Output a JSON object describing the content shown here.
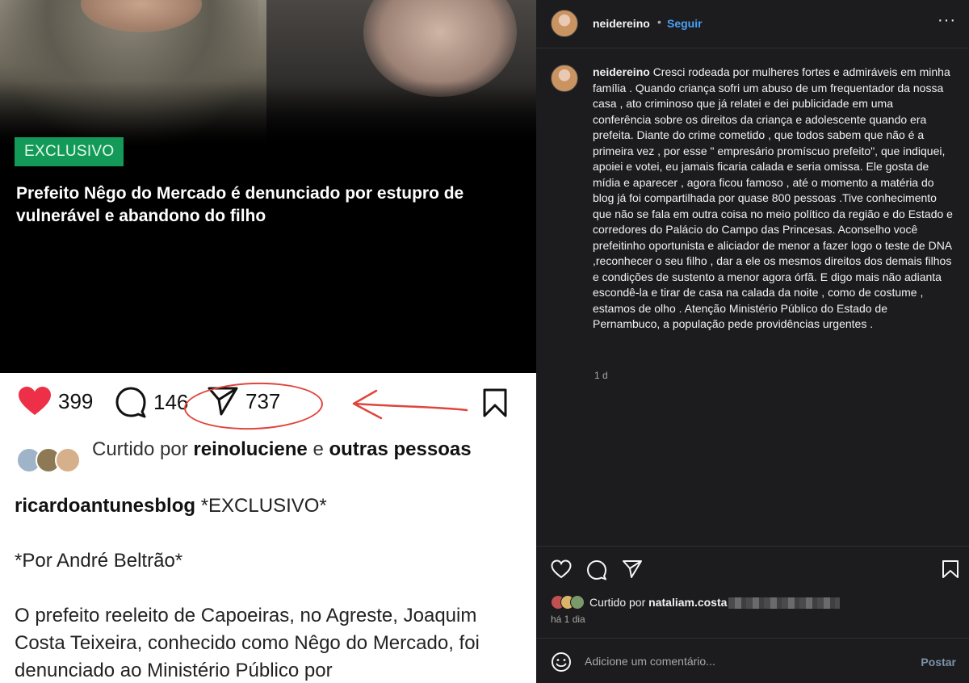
{
  "left": {
    "badge": "EXCLUSIVO",
    "headline": "Prefeito Nêgo do Mercado é denunciado por estupro de vulnerável e abandono do filho",
    "counts": {
      "likes": "399",
      "comments": "146",
      "shares": "737"
    },
    "liked_by": {
      "prefix": "Curtido por",
      "user": "reinoluciene",
      "joiner": "e",
      "rest": "outras pessoas"
    },
    "caption": {
      "user": "ricardoantunesblog",
      "first": "*EXCLUSIVO*",
      "byline": "*Por André Beltrão*",
      "body": "O prefeito reeleito de Capoeiras, no Agreste, Joaquim Costa Teixeira, conhecido como Nêgo do Mercado, foi denunciado ao Ministério Público por"
    },
    "annotation_color": "#e0453c"
  },
  "right": {
    "username": "neidereino",
    "dot": "•",
    "follow": "Seguir",
    "more": "···",
    "comment": {
      "user": "neidereino",
      "text": "Cresci rodeada por mulheres fortes e admiráveis em minha família . Quando criança sofri um abuso de um frequentador da nossa casa , ato criminoso que já relatei e dei publicidade em uma conferência sobre os direitos da criança e adolescente quando era prefeita. Diante do crime cometido , que todos sabem que não é a primeira vez , por esse \" empresário promíscuo prefeito\", que indiquei, apoiei e votei, eu jamais ficaria calada e seria omissa. Ele gosta de mídia e aparecer , agora ficou famoso , até o momento a matéria do blog já foi compartilhada por quase 800 pessoas .Tive conhecimento que não se fala em outra coisa no meio político da região e do Estado e corredores do Palácio do Campo das Princesas. Aconselho você prefeitinho oportunista e aliciador de menor a fazer logo o teste de DNA ,reconhecer o seu filho , dar a ele os mesmos direitos dos demais filhos e condições de sustento a menor agora órfã. E digo mais não adianta escondê-la e tirar de casa na calada da noite , como de costume , estamos de olho . Atenção Ministério Público do Estado de Pernambuco, a população pede providências urgentes .",
      "time": "1 d"
    },
    "likes": {
      "prefix": "Curtido por",
      "user": "nataliam.costa"
    },
    "ago": "há 1 dia",
    "comment_placeholder": "Adicione um comentário...",
    "post_label": "Postar",
    "accent": "#4aa0f5",
    "bg": "#1c1c1e"
  }
}
